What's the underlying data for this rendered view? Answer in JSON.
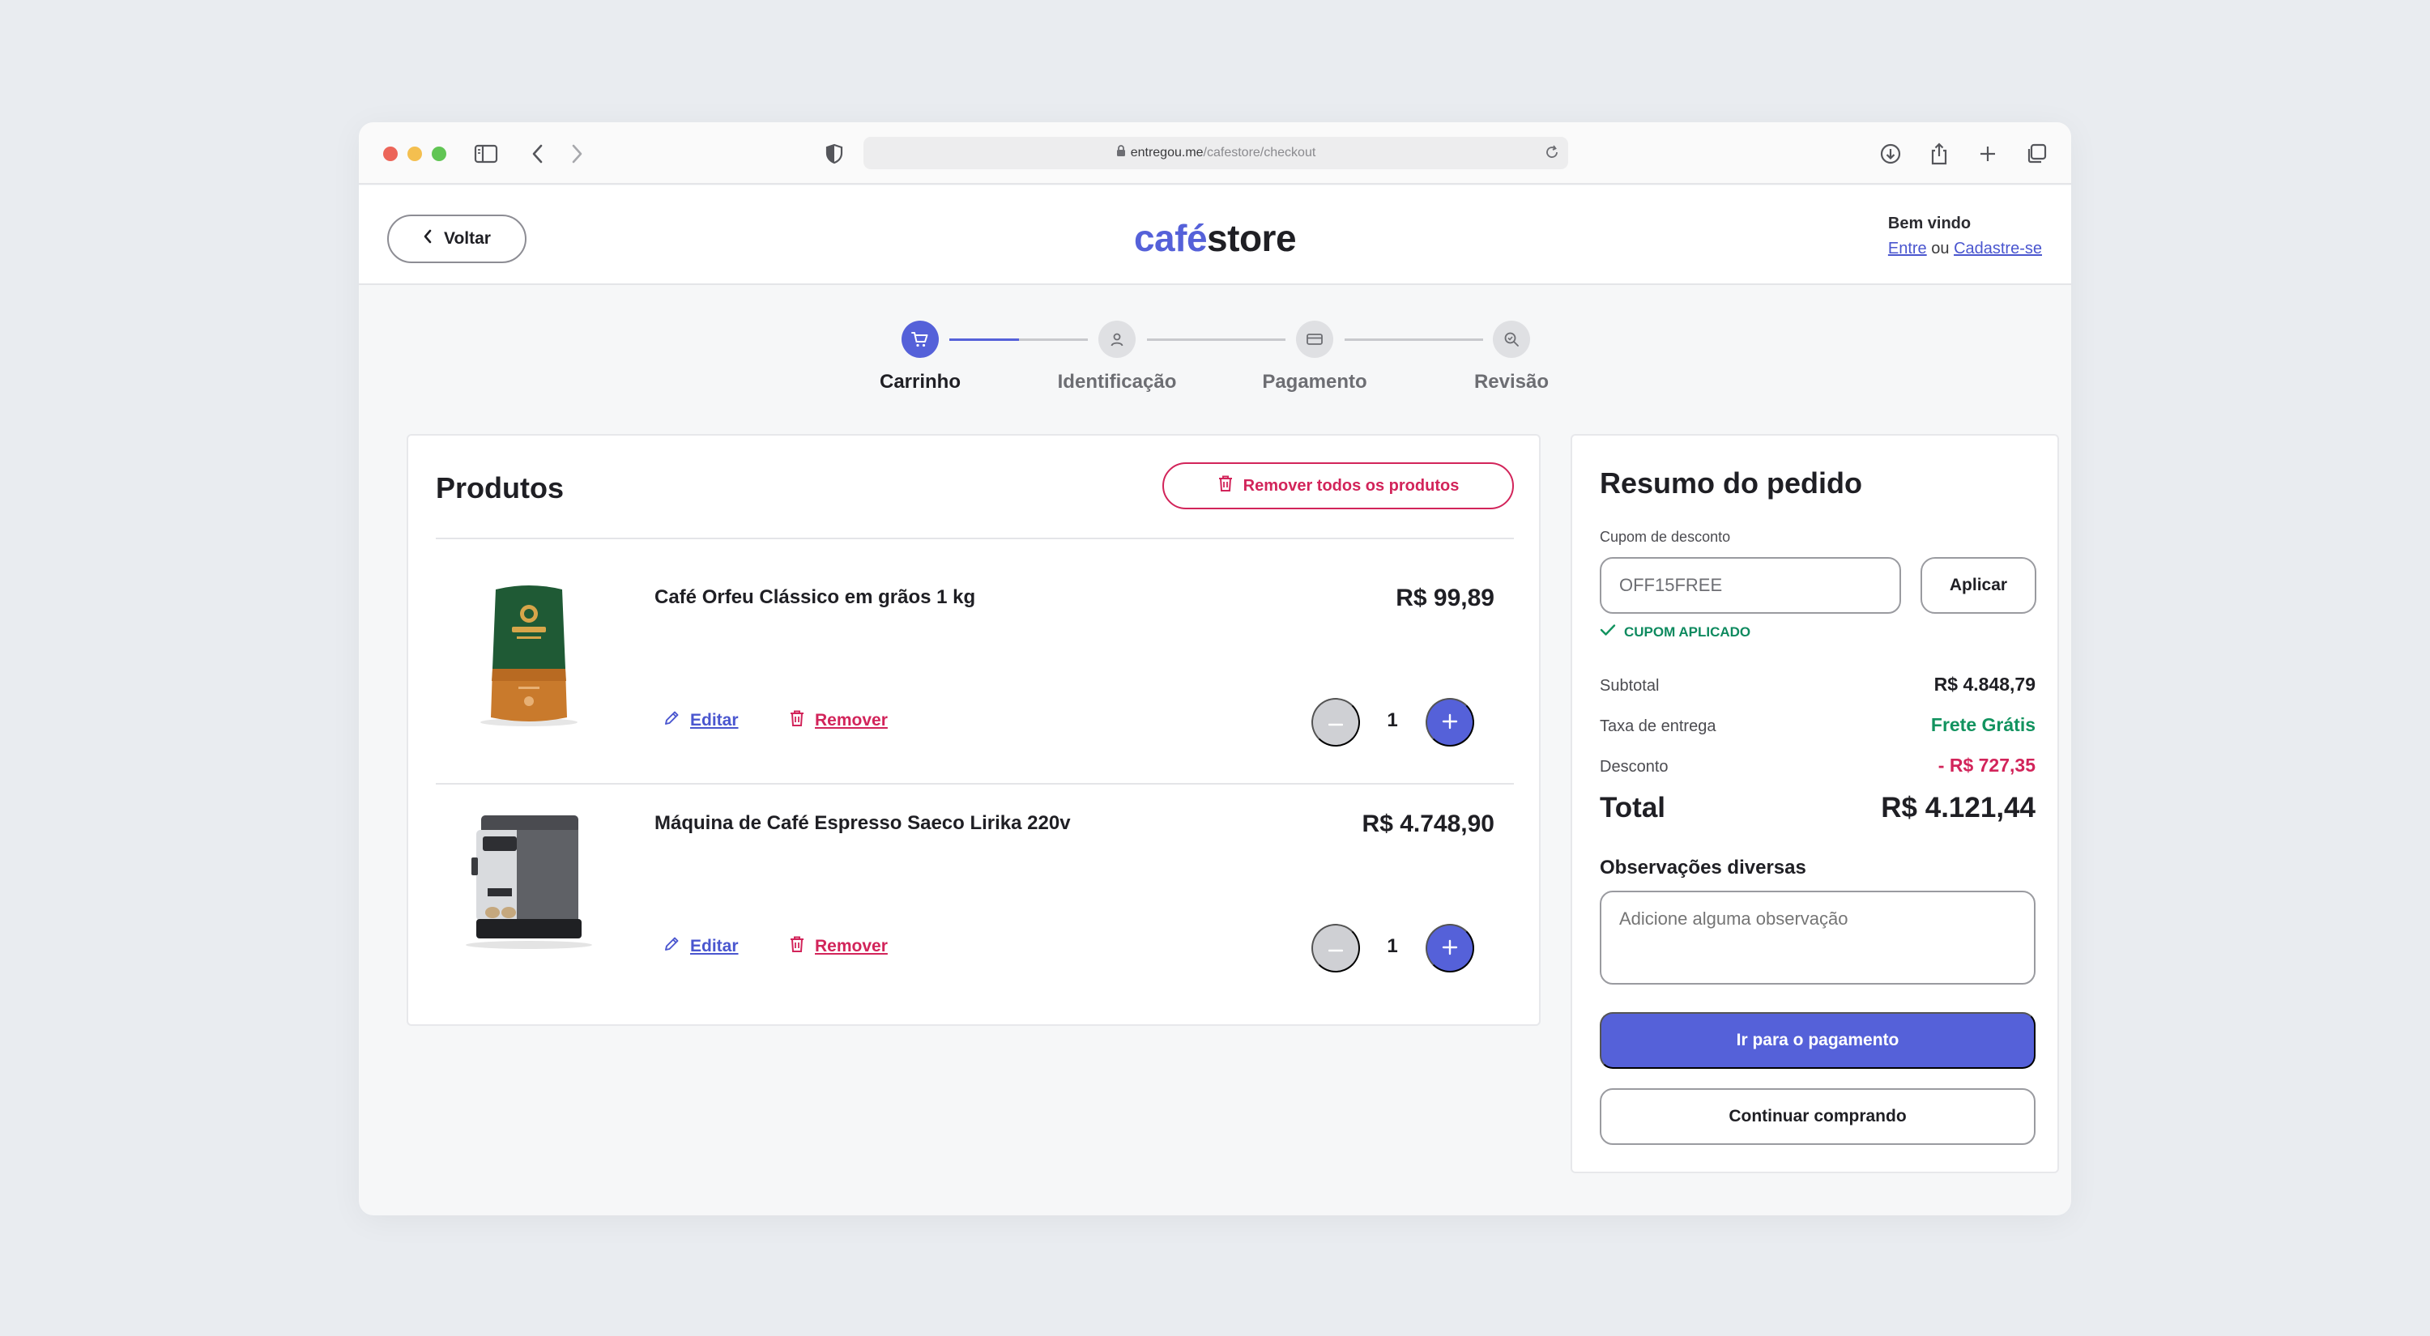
{
  "browser": {
    "url_domain": "entregou.me",
    "url_path": "/cafestore/checkout"
  },
  "header": {
    "back_label": "Voltar",
    "logo_cafe": "café",
    "logo_store": "store",
    "welcome_title": "Bem vindo",
    "login_link": "Entre",
    "or_text": "ou",
    "signup_link": "Cadastre-se"
  },
  "stepper": {
    "steps": [
      {
        "label": "Carrinho",
        "icon": "cart-icon",
        "active": true
      },
      {
        "label": "Identificação",
        "icon": "user-icon",
        "active": false
      },
      {
        "label": "Pagamento",
        "icon": "card-icon",
        "active": false
      },
      {
        "label": "Revisão",
        "icon": "search-check-icon",
        "active": false
      }
    ],
    "progress_first_segment": 0.5
  },
  "products": {
    "title": "Produtos",
    "remove_all_label": "Remover todos os produtos",
    "edit_label": "Editar",
    "remove_label": "Remover",
    "items": [
      {
        "name": "Café Orfeu Clássico em grãos 1 kg",
        "price": "R$ 99,89",
        "quantity": "1"
      },
      {
        "name": "Máquina de Café Espresso Saeco Lirika 220v",
        "price": "R$ 4.748,90",
        "quantity": "1"
      }
    ]
  },
  "summary": {
    "title": "Resumo do pedido",
    "coupon_label": "Cupom de desconto",
    "coupon_value": "OFF15FREE",
    "apply_label": "Aplicar",
    "coupon_status": "CUPOM APLICADO",
    "subtotal_label": "Subtotal",
    "subtotal_value": "R$ 4.848,79",
    "delivery_label": "Taxa de entrega",
    "delivery_value": "Frete Grátis",
    "discount_label": "Desconto",
    "discount_value": "- R$ 727,35",
    "total_label": "Total",
    "total_value": "R$ 4.121,44",
    "notes_title": "Observações diversas",
    "notes_placeholder": "Adicione alguma observação",
    "pay_label": "Ir para o pagamento",
    "continue_label": "Continuar comprando"
  },
  "colors": {
    "accent": "#5561d9",
    "danger": "#d2245a",
    "success": "#12935f"
  }
}
